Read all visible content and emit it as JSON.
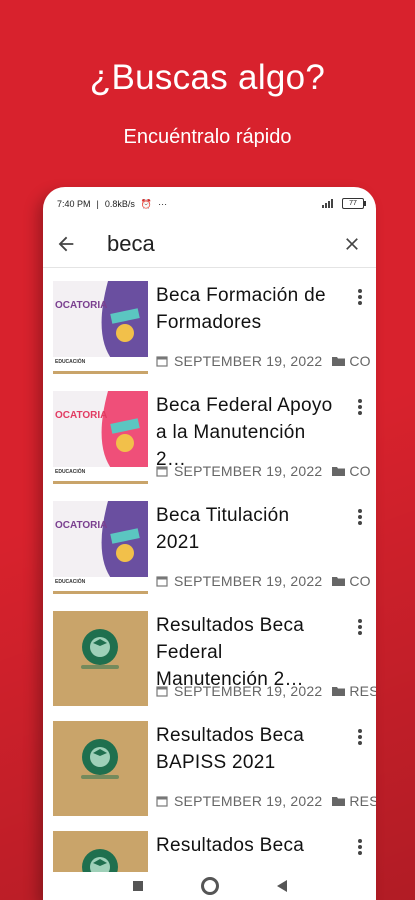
{
  "promo": {
    "headline": "¿Buscas algo?",
    "subline": "Encuéntralo rápido"
  },
  "status_bar": {
    "time": "7:40 PM",
    "speed": "0.8kB/s",
    "battery": "77"
  },
  "search": {
    "query": "beca"
  },
  "results": [
    {
      "title": "Beca Formación de Formadores",
      "date": "SEPTEMBER 19, 2022",
      "category": "CO",
      "thumb_type": "poster",
      "poster_label": "OCATORIA",
      "poster_sub": "EDUCACIÓN"
    },
    {
      "title": "Beca Federal Apoyo a la Manutención 2…",
      "date": "SEPTEMBER 19, 2022",
      "category": "CO",
      "thumb_type": "poster",
      "poster_label": "OCATORIA",
      "poster_sub": "EDUCACIÓN"
    },
    {
      "title": "Beca Titulación 2021",
      "date": "SEPTEMBER 19, 2022",
      "category": "CO",
      "thumb_type": "poster",
      "poster_label": "OCATORIA",
      "poster_sub": "EDUCACIÓN"
    },
    {
      "title": "Resultados Beca Federal Manutención 2…",
      "date": "SEPTEMBER 19, 2022",
      "category": "RES",
      "thumb_type": "icon"
    },
    {
      "title": "Resultados Beca BAPISS 2021",
      "date": "SEPTEMBER 19, 2022",
      "category": "RES",
      "thumb_type": "icon"
    },
    {
      "title": "Resultados Beca",
      "date": "",
      "category": "",
      "thumb_type": "icon"
    }
  ],
  "colors": {
    "brand_red": "#d8222d",
    "tan": "#c9a46a",
    "green": "#1f6f4e",
    "poster_purple": "#6a4fa0",
    "poster_pink": "#ef4f79"
  }
}
